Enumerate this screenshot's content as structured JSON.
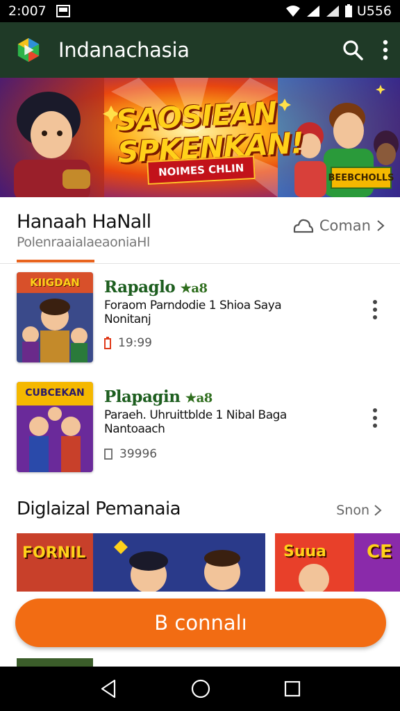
{
  "status_bar": {
    "time": "2:007",
    "battery_text": "U556"
  },
  "app_bar": {
    "title": "Indanachasia",
    "icons": [
      "app-logo",
      "search-icon",
      "more-vert-icon"
    ]
  },
  "hero": {
    "title_line1": "SAOSIEAN",
    "title_line2": "SPKENKAN!",
    "tag": "NOIMES CHLIN",
    "button": "BEEBCHOLLS"
  },
  "section": {
    "title": "Hanaah HaNall",
    "subtitle": "PolenraaialaeaoniaНl",
    "link": "Coman",
    "link_icon": "cloud-icon"
  },
  "items": [
    {
      "title": "Rapaglo",
      "rating": "★a8",
      "desc": "Foraom  Parndodie 1 Shioa Saya Nonitanj",
      "meta": "19:99",
      "meta_icon": "battery-icon",
      "thumb_label": "KIIGDAN"
    },
    {
      "title": "Plapagin",
      "rating": "★a8",
      "desc": "Paraeh. Uhruittblde 1 Nibal Baga Nantoaach",
      "meta": "39996",
      "meta_icon": "document-icon",
      "thumb_label": "CUBCEKAN"
    }
  ],
  "section2": {
    "title": "Diglaizal Pemanaia",
    "link": "Snon"
  },
  "cards": [
    {
      "label": "FORNIL"
    },
    {
      "label": "Suua"
    },
    {
      "label": "CE"
    }
  ],
  "cta": {
    "label": "B connalı"
  },
  "colors": {
    "app_bar_bg": "#1f3a27",
    "accent": "#f26c13",
    "title_green": "#1d5e1f"
  }
}
